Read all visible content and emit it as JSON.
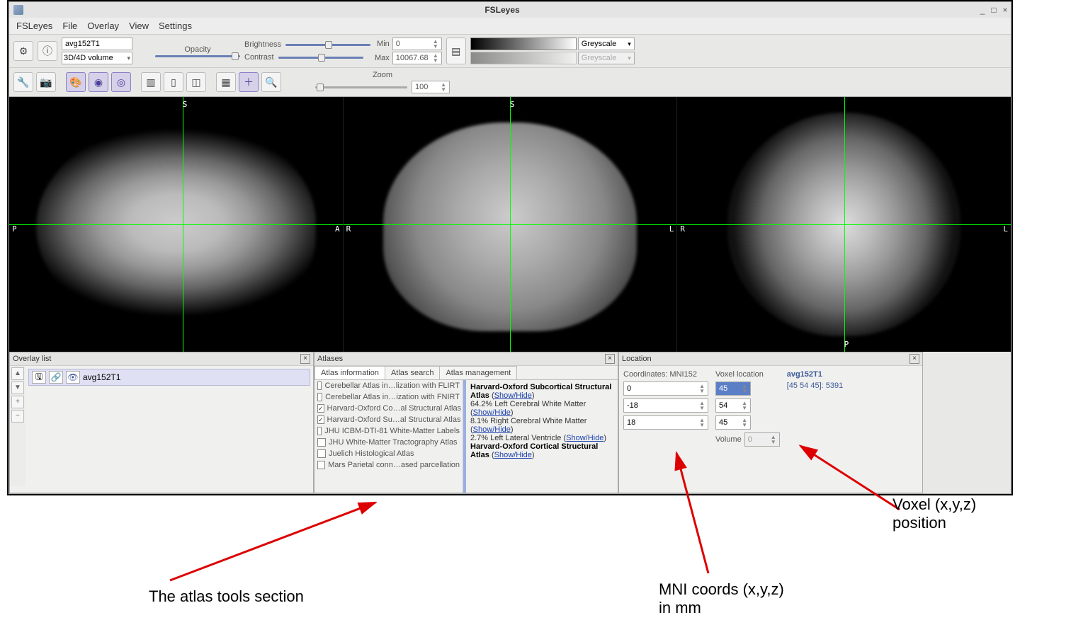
{
  "window": {
    "title": "FSLeyes"
  },
  "menubar": [
    "FSLeyes",
    "File",
    "Overlay",
    "View",
    "Settings"
  ],
  "toolbar1": {
    "overlay_name": "avg152T1",
    "overlay_type": "3D/4D volume",
    "opacity_label": "Opacity",
    "brightness_label": "Brightness",
    "contrast_label": "Contrast",
    "min_label": "Min",
    "max_label": "Max",
    "min_value": "0",
    "max_value": "10067.68",
    "cmap1": "Greyscale",
    "cmap2": "Greyscale"
  },
  "toolbar2": {
    "zoom_label": "Zoom",
    "zoom_value": "100"
  },
  "ortho": {
    "labels": {
      "s": "S",
      "p": "P",
      "a": "A",
      "r": "R",
      "l": "L"
    }
  },
  "panels": {
    "overlay": {
      "title": "Overlay list",
      "item": "avg152T1"
    },
    "atlases": {
      "title": "Atlases",
      "tabs": [
        "Atlas information",
        "Atlas search",
        "Atlas management"
      ],
      "items": [
        {
          "checked": false,
          "label": "Cerebellar Atlas in…lization with FLIRT"
        },
        {
          "checked": false,
          "label": "Cerebellar Atlas in…ization with FNIRT"
        },
        {
          "checked": true,
          "label": "Harvard-Oxford Co…al Structural Atlas"
        },
        {
          "checked": true,
          "label": "Harvard-Oxford Su…al Structural Atlas"
        },
        {
          "checked": false,
          "label": "JHU ICBM-DTI-81 White-Matter Labels"
        },
        {
          "checked": false,
          "label": "JHU White-Matter Tractography Atlas"
        },
        {
          "checked": false,
          "label": "Juelich Histological Atlas"
        },
        {
          "checked": false,
          "label": "Mars Parietal conn…ased parcellation"
        }
      ],
      "info": {
        "h1": "Harvard-Oxford Subcortical Structural Atlas",
        "sh": "Show/Hide",
        "l1": "64.2% Left Cerebral White Matter",
        "l2": "8.1% Right Cerebral White Matter",
        "l3": "2.7% Left Lateral Ventricle",
        "h2": "Harvard-Oxford Cortical Structural Atlas"
      }
    },
    "location": {
      "title": "Location",
      "coords_label": "Coordinates: MNI152",
      "voxel_label": "Voxel location",
      "volume_label": "Volume",
      "mni": [
        "0",
        "-18",
        "18"
      ],
      "voxel": [
        "45",
        "54",
        "45"
      ],
      "volume": "0",
      "overlay_name": "avg152T1",
      "overlay_info": "[45 54 45]: 5391"
    }
  },
  "annotations": {
    "atlas": "The atlas tools section",
    "mni": "MNI coords (x,y,z) in mm",
    "voxel": "Voxel (x,y,z) position"
  }
}
